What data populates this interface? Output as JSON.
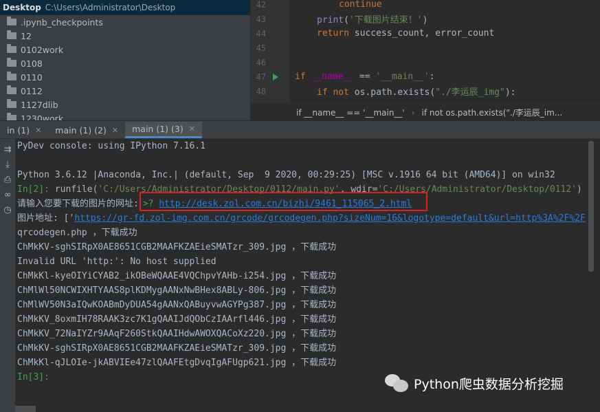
{
  "project": {
    "root_name": "Desktop",
    "root_path": "C:\\Users\\Administrator\\Desktop",
    "items": [
      ".ipynb_checkpoints",
      "12",
      "0102work",
      "0108",
      "0110",
      "0112",
      "1127dlib",
      "1230work"
    ]
  },
  "editor": {
    "lines": [
      {
        "num": "42",
        "html": "<span class=\"kw\">continue</span>",
        "indent": 64
      },
      {
        "num": "43",
        "html": "<span class=\"builtin\">print</span>(<span class=\"str\">'下载图片结束！'</span>)",
        "indent": 32
      },
      {
        "num": "44",
        "html": "<span class=\"kw\">return </span>success_count, error_count",
        "indent": 32
      },
      {
        "num": "45",
        "html": "",
        "indent": 0
      },
      {
        "num": "46",
        "html": "",
        "indent": 0
      },
      {
        "num": "47",
        "html": "<span class=\"kw\">if </span><span class=\"dunder\">__name__</span> == <span class=\"str\">'__main__'</span>:",
        "indent": 0
      },
      {
        "num": "48",
        "html": "<span class=\"kw\">if not </span>os.path.exists(<span class=\"str\">\"./李运辰_img\"</span>):",
        "indent": 32
      }
    ],
    "breadcrumb": [
      "if __name__ == '__main__'",
      "if not os.path.exists(\"./李运辰_im..."
    ]
  },
  "tabs": [
    {
      "label": "in (1)",
      "active": false
    },
    {
      "label": "main (1) (2)",
      "active": false
    },
    {
      "label": "main (1) (3)",
      "active": true
    }
  ],
  "console": {
    "header": "PyDev console: using IPython 7.16.1",
    "python_info": "Python 3.6.12 |Anaconda, Inc.| (default, Sep  9 2020, 00:29:25) [MSC v.1916 64 bit (AMD64)] on win32",
    "prompt2": "In[2]:",
    "runfile_pre": " runfile(",
    "runfile_arg1": "'C:/Users/Administrator/Desktop/0112/main.py'",
    "runfile_mid": ", wdir=",
    "runfile_arg2": "'C:/Users/Administrator/Desktop/0112'",
    "runfile_post": ")",
    "input_prompt": "请输入您要下载的图片的网址:",
    "input_marker": ">?",
    "input_url": "http://desk.zol.com.cn/bizhi/9461_115065_2.html",
    "img_addr_label": "图片地址: ['",
    "img_addr_url": "https://gr-fd.zol-img.com.cn/grcode/grcodegen.php?sizeNum=16&logotype=default&url=http%3A%2F%2F",
    "output_lines": [
      "qrcodegen.php ，下载成功",
      "ChMkKV-sghSIRpX0AE8651CGB2MAAFKZAEieSMATzr_309.jpg ，下载成功",
      "Invalid URL 'http:': No host supplied",
      "ChMkKl-kyeOIYiCYAB2_ikOBeWQAAE4VQChpvYAHb-i254.jpg ，下载成功",
      "ChMlWl50NCWIXHTYAAS8plKDMygAANxNwBHex8ABLy-806.jpg ，下载成功",
      "ChMlWV50N3aIQwKOABmDyDUA54gAANxQABuyvwAGYPg387.jpg ，下载成功",
      "ChMkKV_8oxmIH78RAAK3zc7K1gQAAIJdQObCzIAArfl446.jpg ，下载成功",
      "ChMkKV_72NaIYZr9AAqF260StkQAAIHdwAWOXQACoXz220.jpg ，下载成功",
      "ChMkKV-sghSIRpX0AE8651CGB2MAAFKZAEieSMATzr_309.jpg ，下载成功",
      "ChMkKl-qJLOIe-jkABVIEe47zlQAAFEtgDvqIgAFUgp621.jpg ，下载成功"
    ],
    "prompt3": "In[3]:"
  },
  "watermark": "Python爬虫数据分析挖掘",
  "colors": {
    "accent": "#4a88c7",
    "highlight_box": "#e02020",
    "link": "#287bde",
    "prompt": "#499c54"
  }
}
